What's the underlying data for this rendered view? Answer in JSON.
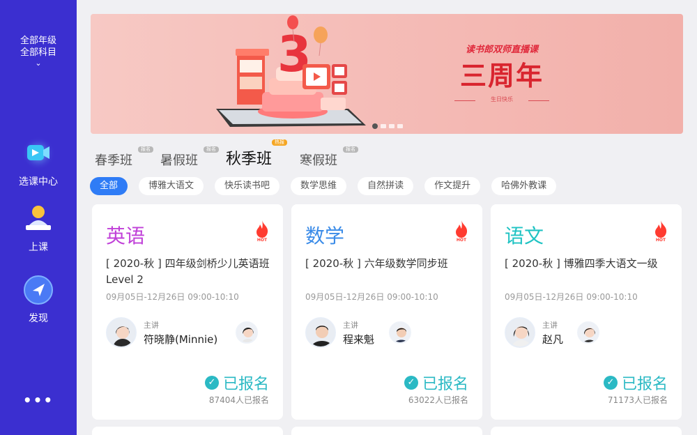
{
  "sidebar": {
    "grade_line1": "全部年级",
    "grade_line2": "全部科目",
    "chevron": "⌄",
    "nav": [
      {
        "label": "选课中心",
        "icon": "video-course-icon"
      },
      {
        "label": "上课",
        "icon": "teacher-desk-icon"
      },
      {
        "label": "发现",
        "icon": "compass-arrow-icon"
      }
    ],
    "more": "•••"
  },
  "banner": {
    "subtitle": "读书郎双师直播课",
    "title": "三周年",
    "tag": "生日快乐",
    "dots_count": 4,
    "active_dot": 0
  },
  "term_tabs": [
    {
      "label": "春季班",
      "badge": "报名",
      "active": false
    },
    {
      "label": "暑假班",
      "badge": "报名",
      "active": false
    },
    {
      "label": "秋季班",
      "badge": "热报",
      "active": true
    },
    {
      "label": "寒假班",
      "badge": "报名",
      "active": false
    }
  ],
  "categories": [
    "全部",
    "博雅大语文",
    "快乐读书吧",
    "数学思维",
    "自然拼读",
    "作文提升",
    "哈佛外教课"
  ],
  "active_category": 0,
  "courses": [
    {
      "subject": "英语",
      "subject_color": "#c040d8",
      "title": "[ 2020-秋 ] 四年级剑桥少儿英语班Level 2",
      "date": "09月05日-12月26日 09:00-10:10",
      "teacher_role": "主讲",
      "teacher_name": "符晓静(Minnie)",
      "status": "已报名",
      "count": "87404人已报名"
    },
    {
      "subject": "数学",
      "subject_color": "#3a8be8",
      "title": "[ 2020-秋 ] 六年级数学同步班",
      "date": "09月05日-12月26日 09:00-10:10",
      "teacher_role": "主讲",
      "teacher_name": "程来魁",
      "status": "已报名",
      "count": "63022人已报名"
    },
    {
      "subject": "语文",
      "subject_color": "#1fc3c3",
      "title": "[ 2020-秋 ] 博雅四季大语文一级",
      "date": "09月05日-12月26日 09:00-10:10",
      "teacher_role": "主讲",
      "teacher_name": "赵凡",
      "status": "已报名",
      "count": "71173人已报名"
    }
  ],
  "colors": {
    "sidebar": "#3b2fd0",
    "accent_blue": "#2f7cf6",
    "enrolled": "#2bb9c4",
    "hot": "#ff3b30"
  }
}
